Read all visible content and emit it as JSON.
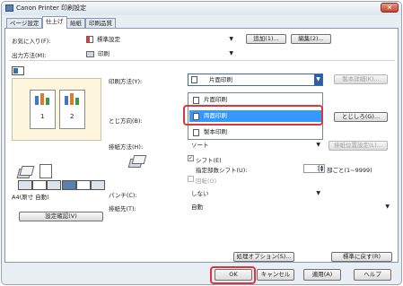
{
  "window": {
    "title": "Canon Printer 印刷設定",
    "close_glyph": "✕"
  },
  "tabs": [
    {
      "label": "ページ設定"
    },
    {
      "label": "仕上げ"
    },
    {
      "label": "給紙"
    },
    {
      "label": "印刷品質"
    }
  ],
  "favorites": {
    "label": "お気に入り(F):",
    "value": "標準設定",
    "add_button": "追加(1)...",
    "edit_button": "編集(2)..."
  },
  "output_method": {
    "label": "出力方法(M):",
    "value": "印刷"
  },
  "print_method": {
    "label": "印刷方法(Y):",
    "value": "片面印刷",
    "detail_button": "製本詳細(K)...",
    "options": [
      "片面印刷",
      "両面印刷",
      "製本印刷"
    ],
    "selected_index": 1
  },
  "binding": {
    "label": "とじ方向(B):",
    "margin_button": "とじしろ(G)..."
  },
  "paper_output": {
    "label": "排紙方法(H):",
    "value": "ソート",
    "detail_button": "排紙位置設定(L)..."
  },
  "shift": {
    "label": "シフト(E)",
    "checked": true,
    "per_label": "指定部数シフト(U):",
    "value": "1",
    "suffix": "部ごと(1~9999)"
  },
  "rotate": {
    "label": "回転(O)"
  },
  "punch": {
    "label": "パンチ(C):",
    "value": "しない"
  },
  "output_destination": {
    "label": "排紙先(T):",
    "value": "自動"
  },
  "preview": {
    "page_numbers": [
      "1",
      "2"
    ],
    "status": "A4(原寸 自動)",
    "confirm_button": "設定確認(V)"
  },
  "bottom_buttons": {
    "finishing_options": "処理オプション(S)...",
    "restore_defaults": "標準に戻す(R)"
  },
  "dialog_buttons": {
    "ok": "OK",
    "cancel": "キャンセル",
    "apply": "適用(A)",
    "help": "ヘルプ"
  },
  "colors": {
    "highlight": "#e0333a",
    "selection": "#3399ff"
  }
}
